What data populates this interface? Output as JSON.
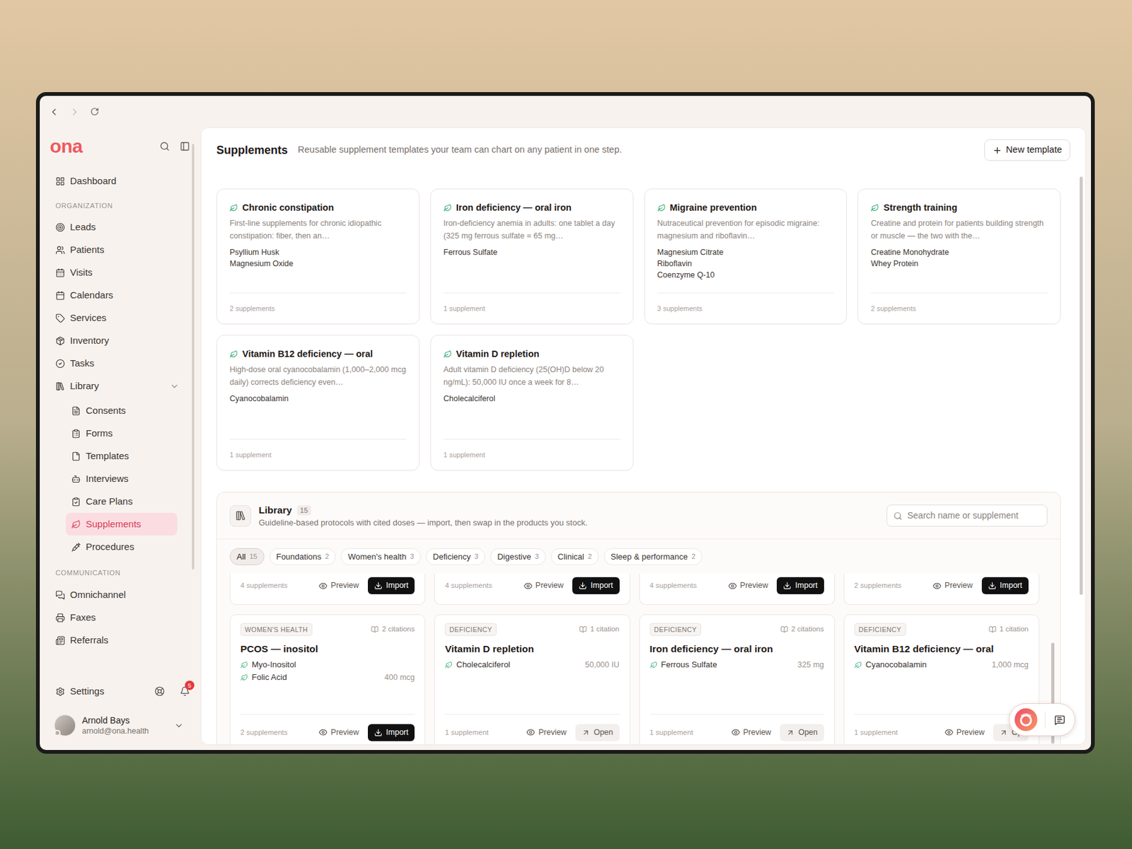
{
  "browser": {
    "back": {
      "disabled": false
    },
    "forward": {
      "disabled": true
    }
  },
  "sidebar": {
    "logo": "ona",
    "top_items": [
      {
        "label": "Dashboard",
        "selected": false
      }
    ],
    "sections": [
      {
        "heading": "ORGANIZATION",
        "items": [
          {
            "label": "Leads",
            "selected": false
          },
          {
            "label": "Patients",
            "selected": false
          },
          {
            "label": "Visits",
            "selected": false
          },
          {
            "label": "Calendars",
            "selected": false
          },
          {
            "label": "Services",
            "selected": false
          },
          {
            "label": "Inventory",
            "selected": false
          },
          {
            "label": "Tasks",
            "selected": false
          },
          {
            "label": "Library",
            "selected": false,
            "expanded": true,
            "children": [
              {
                "label": "Consents",
                "selected": false
              },
              {
                "label": "Forms",
                "selected": false
              },
              {
                "label": "Templates",
                "selected": false
              },
              {
                "label": "Interviews",
                "selected": false
              },
              {
                "label": "Care Plans",
                "selected": false
              },
              {
                "label": "Supplements",
                "selected": true
              },
              {
                "label": "Procedures",
                "selected": false
              }
            ]
          }
        ]
      },
      {
        "heading": "COMMUNICATION",
        "items": [
          {
            "label": "Omnichannel",
            "selected": false
          },
          {
            "label": "Faxes",
            "selected": false
          },
          {
            "label": "Referrals",
            "selected": false
          }
        ]
      }
    ],
    "settings": {
      "label": "Settings"
    },
    "notifications": {
      "count": "5"
    },
    "user": {
      "name": "Arnold Bays",
      "email": "arnold@ona.health"
    }
  },
  "page": {
    "title": "Supplements",
    "subtitle": "Reusable supplement templates your team can chart on any patient in one step.",
    "new_button": "New template"
  },
  "templates": [
    {
      "title": "Chronic constipation",
      "description": "First-line supplements for chronic idiopathic constipation: fiber, then an…",
      "supplements": [
        "Psyllium Husk",
        "Magnesium Oxide"
      ],
      "count": "2 supplements"
    },
    {
      "title": "Iron deficiency — oral iron",
      "description": "Iron-deficiency anemia in adults: one tablet a day (325 mg ferrous sulfate = 65 mg…",
      "supplements": [
        "Ferrous Sulfate"
      ],
      "count": "1 supplement"
    },
    {
      "title": "Migraine prevention",
      "description": "Nutraceutical prevention for episodic migraine: magnesium and riboflavin…",
      "supplements": [
        "Magnesium Citrate",
        "Riboflavin",
        "Coenzyme Q-10"
      ],
      "count": "3 supplements"
    },
    {
      "title": "Strength training",
      "description": "Creatine and protein for patients building strength or muscle — the two with the…",
      "supplements": [
        "Creatine Monohydrate",
        "Whey Protein"
      ],
      "count": "2 supplements"
    },
    {
      "title": "Vitamin B12 deficiency — oral",
      "description": "High-dose oral cyanocobalamin (1,000–2,000 mcg daily) corrects deficiency even…",
      "supplements": [
        "Cyanocobalamin"
      ],
      "count": "1 supplement"
    },
    {
      "title": "Vitamin D repletion",
      "description": "Adult vitamin D deficiency (25(OH)D below 20 ng/mL): 50,000 IU once a week for 8…",
      "supplements": [
        "Cholecalciferol"
      ],
      "count": "1 supplement"
    }
  ],
  "library": {
    "title": "Library",
    "count": "15",
    "subtitle": "Guideline-based protocols with cited doses — import, then swap in the products you stock.",
    "search": {
      "placeholder": "Search name or supplement"
    },
    "filters": [
      {
        "label": "All",
        "count": "15",
        "selected": true
      },
      {
        "label": "Foundations",
        "count": "2",
        "selected": false
      },
      {
        "label": "Women's health",
        "count": "3",
        "selected": false
      },
      {
        "label": "Deficiency",
        "count": "3",
        "selected": false
      },
      {
        "label": "Digestive",
        "count": "3",
        "selected": false
      },
      {
        "label": "Clinical",
        "count": "2",
        "selected": false
      },
      {
        "label": "Sleep & performance",
        "count": "2",
        "selected": false
      }
    ],
    "cards": [
      {
        "kind": "clipped",
        "count": "4 supplements",
        "preview": "Preview",
        "action": {
          "label": "Import",
          "kind": "import"
        }
      },
      {
        "kind": "clipped",
        "count": "4 supplements",
        "preview": "Preview",
        "action": {
          "label": "Import",
          "kind": "import"
        }
      },
      {
        "kind": "clipped",
        "count": "4 supplements",
        "preview": "Preview",
        "action": {
          "label": "Import",
          "kind": "import"
        }
      },
      {
        "kind": "clipped",
        "count": "2 supplements",
        "preview": "Preview",
        "action": {
          "label": "Import",
          "kind": "import"
        }
      },
      {
        "kind": "full",
        "tag": "WOMEN'S HEALTH",
        "citations": "2 citations",
        "title": "PCOS — inositol",
        "supplements": [
          {
            "name": "Myo-Inositol"
          },
          {
            "name": "Folic Acid",
            "dose": "400 mcg"
          }
        ],
        "count": "2 supplements",
        "preview": "Preview",
        "action": {
          "label": "Import",
          "kind": "import"
        }
      },
      {
        "kind": "full",
        "tag": "DEFICIENCY",
        "citations": "1 citation",
        "title": "Vitamin D repletion",
        "supplements": [
          {
            "name": "Cholecalciferol",
            "dose": "50,000 IU"
          }
        ],
        "count": "1 supplement",
        "preview": "Preview",
        "action": {
          "label": "Open",
          "kind": "open"
        }
      },
      {
        "kind": "full",
        "tag": "DEFICIENCY",
        "citations": "2 citations",
        "title": "Iron deficiency — oral iron",
        "supplements": [
          {
            "name": "Ferrous Sulfate",
            "dose": "325 mg"
          }
        ],
        "count": "1 supplement",
        "preview": "Preview",
        "action": {
          "label": "Open",
          "kind": "open"
        }
      },
      {
        "kind": "full",
        "tag": "DEFICIENCY",
        "citations": "1 citation",
        "title": "Vitamin B12 deficiency — oral",
        "supplements": [
          {
            "name": "Cyanocobalamin",
            "dose": "1,000 mcg"
          }
        ],
        "count": "1 supplement",
        "preview": "Preview",
        "action": {
          "label": "Op",
          "kind": "open"
        }
      }
    ]
  }
}
